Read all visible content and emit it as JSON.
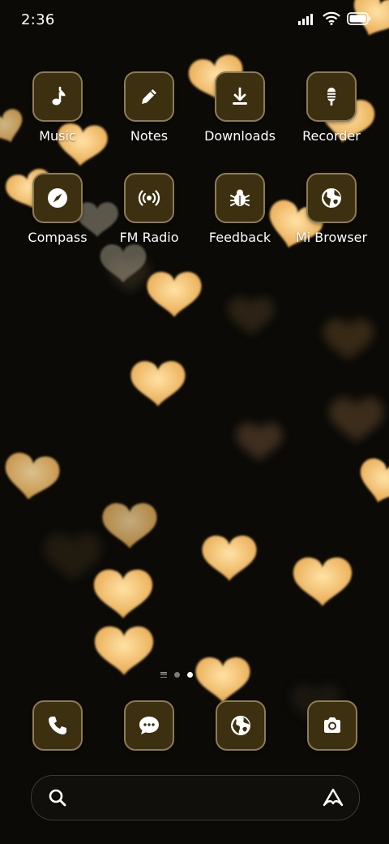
{
  "status_bar": {
    "time": "2:36"
  },
  "apps": [
    {
      "label": "Music",
      "icon": "music-note-icon"
    },
    {
      "label": "Notes",
      "icon": "pencil-icon"
    },
    {
      "label": "Downloads",
      "icon": "download-icon"
    },
    {
      "label": "Recorder",
      "icon": "microphone-icon"
    },
    {
      "label": "Compass",
      "icon": "compass-icon"
    },
    {
      "label": "FM Radio",
      "icon": "radio-icon"
    },
    {
      "label": "Feedback",
      "icon": "bug-icon"
    },
    {
      "label": "Mi Browser",
      "icon": "globe-icon"
    }
  ],
  "dock": [
    {
      "name": "Phone",
      "icon": "phone-icon"
    },
    {
      "name": "Messaging",
      "icon": "chat-bubble-icon"
    },
    {
      "name": "Browser",
      "icon": "globe-icon"
    },
    {
      "name": "Camera",
      "icon": "camera-icon"
    }
  ],
  "page_indicator": {
    "pages": 2,
    "current": 2
  },
  "search_bar": {
    "icon": "search-icon",
    "assistant_icon": "assistant-icon"
  },
  "colors": {
    "tile_bg": "#3c3011",
    "tile_border": "#8c7c56",
    "heart": "#f4c275"
  }
}
